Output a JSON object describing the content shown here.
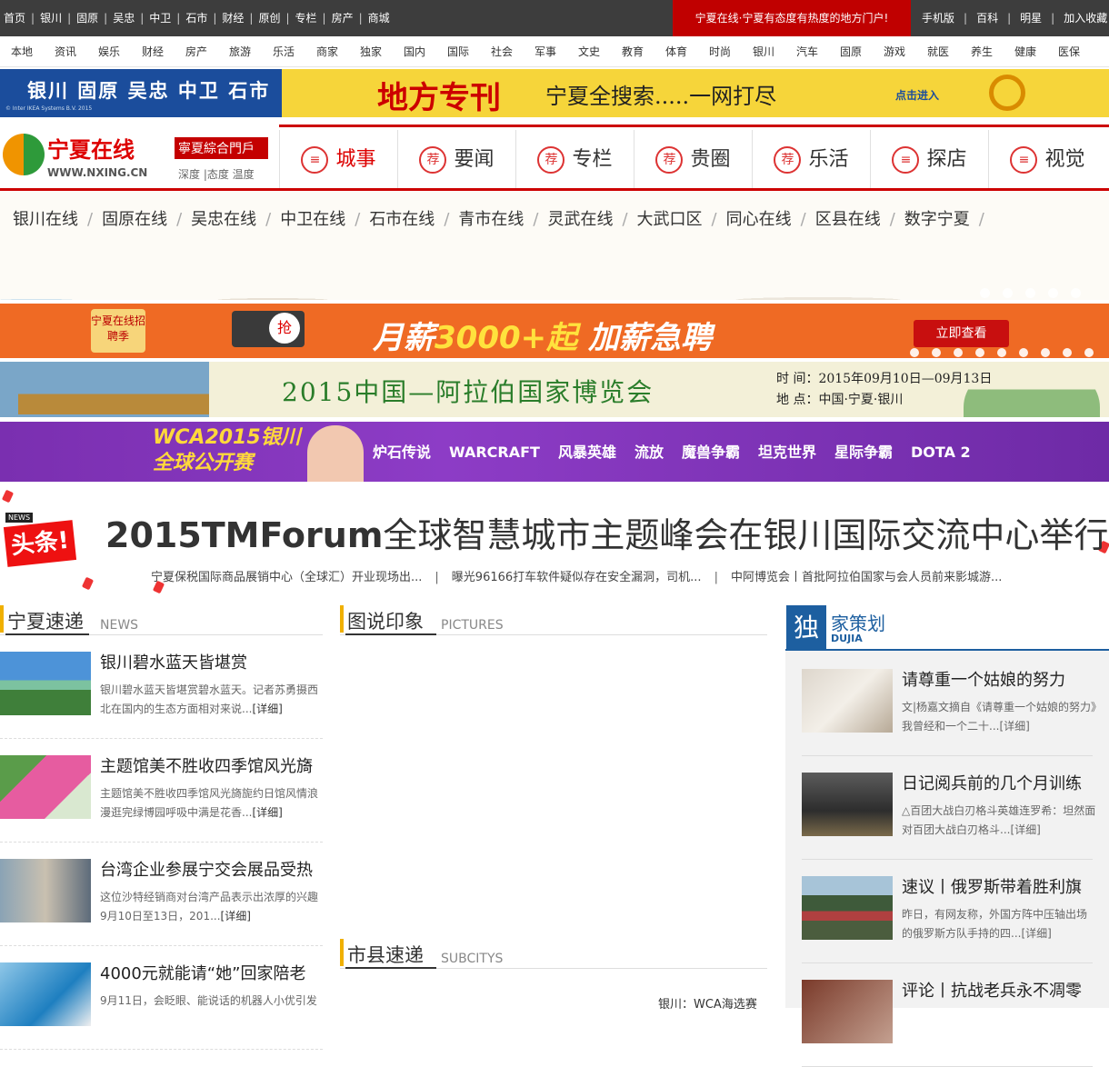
{
  "topbar": {
    "left_links": [
      "首页",
      "银川",
      "固原",
      "吴忠",
      "中卫",
      "石市",
      "财经",
      "原创",
      "专栏",
      "房产",
      "商城"
    ],
    "promo": "宁夏在线·宁夏有态度有热度的地方门户!",
    "right_links": [
      "手机版",
      "百科",
      "明星",
      "加入收藏"
    ]
  },
  "categories": [
    "本地",
    "资讯",
    "娱乐",
    "财经",
    "房产",
    "旅游",
    "乐活",
    "商家",
    "独家",
    "国内",
    "国际",
    "社会",
    "军事",
    "文史",
    "教育",
    "体育",
    "时尚",
    "银川",
    "汽车",
    "固原",
    "游戏",
    "就医",
    "养生",
    "健康",
    "医保"
  ],
  "banner_top": {
    "cities": "银川 固原 吴忠 中卫 石市",
    "calligraphy": "地方专刊",
    "slogan": "宁夏全搜索.....一网打尽",
    "cta": "点击进入",
    "copyright": "© Inter IKEA Systems B.V. 2015"
  },
  "logo": {
    "name": "宁夏在线",
    "url": "WWW.NXING.CN",
    "portal": "寧夏綜合門戶",
    "tagline": "深度 |态度 温度"
  },
  "nav_tabs": [
    {
      "icon": "list-icon",
      "glyph": "≡",
      "label": "城事",
      "active": true
    },
    {
      "icon": "recommend-icon",
      "glyph": "荐",
      "label": "要闻",
      "active": false
    },
    {
      "icon": "recommend-icon",
      "glyph": "荐",
      "label": "专栏",
      "active": false
    },
    {
      "icon": "recommend-icon",
      "glyph": "荐",
      "label": "贵圈",
      "active": false
    },
    {
      "icon": "recommend-icon",
      "glyph": "荐",
      "label": "乐活",
      "active": false
    },
    {
      "icon": "list-icon",
      "glyph": "≡",
      "label": "探店",
      "active": false
    },
    {
      "icon": "list-icon",
      "glyph": "≡",
      "label": "视觉",
      "active": false
    }
  ],
  "sub_nav": [
    "银川在线",
    "固原在线",
    "吴忠在线",
    "中卫在线",
    "石市在线",
    "青市在线",
    "灵武在线",
    "大武口区",
    "同心在线",
    "区县在线",
    "数字宁夏"
  ],
  "banner_recruit": {
    "logo": "宁夏在线招聘季",
    "grab": "抢",
    "salary_prefix": "月薪",
    "salary_num": "3000+起",
    "salary_suffix": "加薪急聘",
    "cta": "立即查看"
  },
  "banner_expo": {
    "title": "2015中国—阿拉伯国家博览会",
    "time": "时 间：2015年09月10日—09月13日",
    "place": "地 点：中国·宁夏·银川"
  },
  "banner_wca": {
    "line1": "WCA2015银川",
    "line2": "全球公开赛",
    "games": [
      "炉石传说",
      "WARCRAFT",
      "风暴英雄",
      "流放",
      "魔兽争霸",
      "坦克世界",
      "星际争霸",
      "DOTA 2"
    ]
  },
  "headline": {
    "badge_news": "NEWS",
    "badge_text": "头条!",
    "title_bold": "2015TMForum",
    "title_rest": "全球智慧城市主题峰会在银川国际交流中心举行",
    "subs": [
      "宁夏保税国际商品展销中心（全球汇）开业现场出...",
      "曝光96166打车软件疑似存在安全漏洞，司机...",
      "中阿博览会丨首批阿拉伯国家与会人员前来影城游..."
    ]
  },
  "section_express": {
    "zh": "宁夏速递",
    "en": "NEWS",
    "items": [
      {
        "title": "银川碧水蓝天皆堪赏",
        "desc": "银川碧水蓝天皆堪赏碧水蓝天。记者苏勇摄西北在国内的生态方面相对来说...",
        "more": "[详细]"
      },
      {
        "title": "主题馆美不胜收四季馆风光旖",
        "desc": "主题馆美不胜收四季馆风光旖旎约日馆风情浪漫逛完绿博园呼吸中满是花香...",
        "more": "[详细]"
      },
      {
        "title": "台湾企业参展宁交会展品受热",
        "desc": "这位沙特经销商对台湾产品表示出浓厚的兴趣9月10日至13日，201...",
        "more": "[详细]"
      },
      {
        "title": "4000元就能请“她”回家陪老",
        "desc": "9月11日，会眨眼、能说话的机器人小优引发",
        "more": ""
      }
    ]
  },
  "section_pictures": {
    "zh": "图说印象",
    "en": "PICTURES"
  },
  "section_subcity": {
    "zh": "市县速递",
    "en": "SUBCITYS",
    "first_item": "银川：WCA海选赛"
  },
  "section_exclusive": {
    "badge": "独",
    "zh": "家策划",
    "en": "DUJIA",
    "items": [
      {
        "title": "请尊重一个姑娘的努力",
        "desc": "文|杨嘉文摘自《请尊重一个姑娘的努力》我曾经和一个二十...",
        "more": "[详细]"
      },
      {
        "title": "日记阅兵前的几个月训练",
        "desc": "△百团大战白刃格斗英雄连罗希：坦然面对百团大战白刃格斗...",
        "more": "[详细]"
      },
      {
        "title": "速议丨俄罗斯带着胜利旗",
        "desc": "昨日，有网友称，外国方阵中压轴出场的俄罗斯方队手持的四...",
        "more": "[详细]"
      },
      {
        "title": "评论丨抗战老兵永不凋零",
        "desc": "",
        "more": ""
      }
    ]
  }
}
